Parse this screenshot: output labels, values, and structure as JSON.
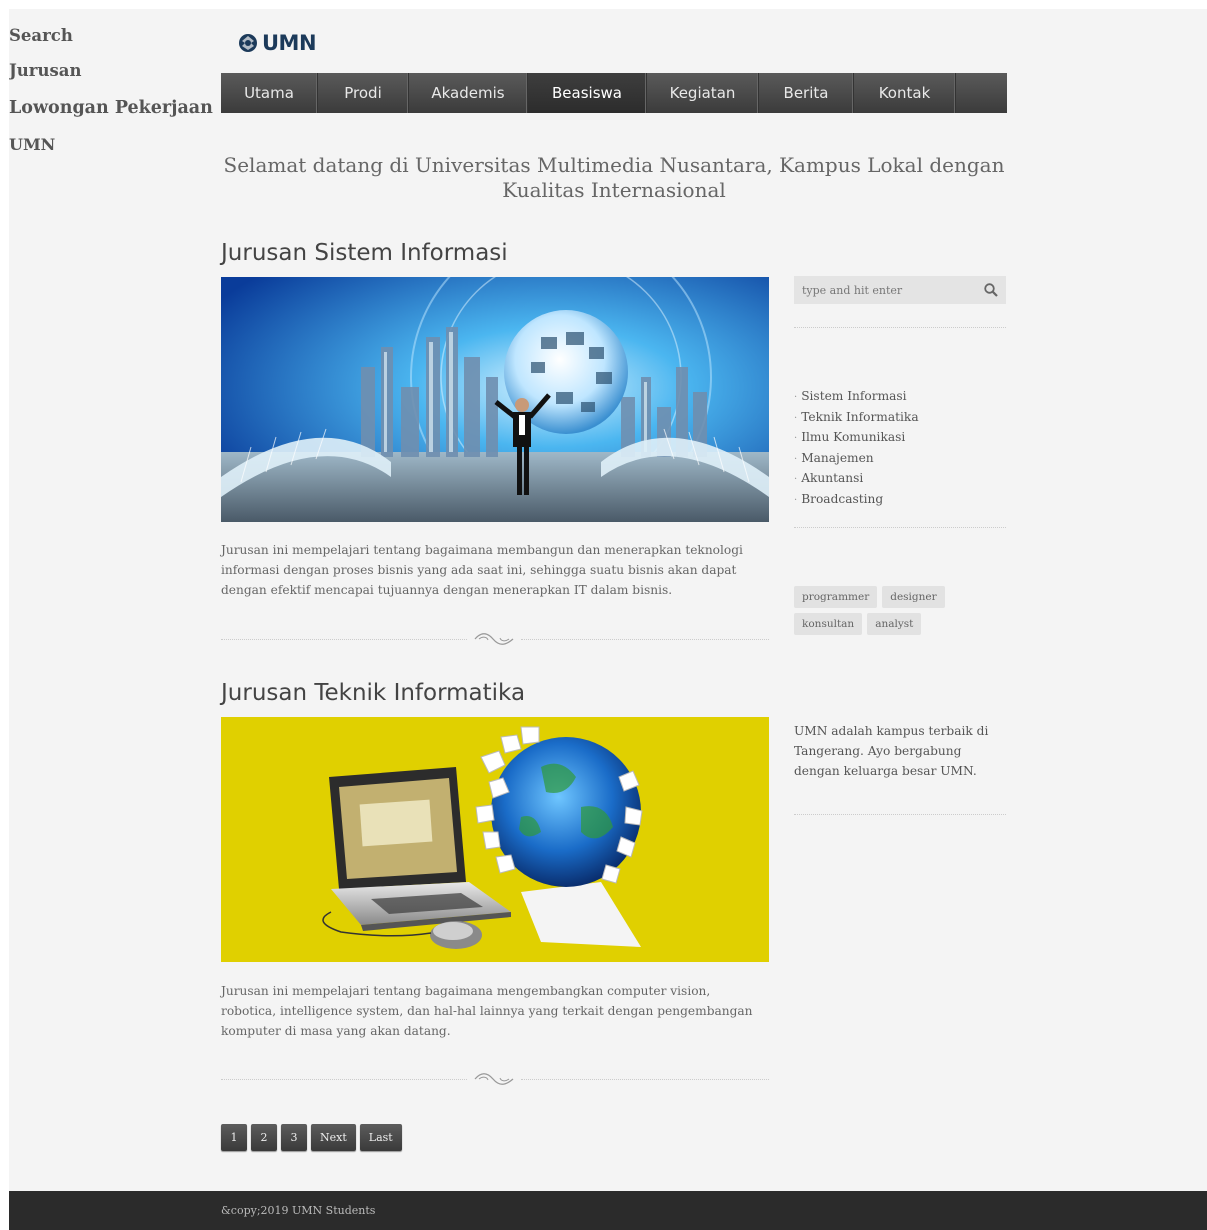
{
  "logo": {
    "text": "UMN"
  },
  "nav": {
    "items": [
      "Utama",
      "Prodi",
      "Akademis",
      "Beasiswa",
      "Kegiatan",
      "Berita",
      "Kontak"
    ],
    "active": "Beasiswa"
  },
  "tagline": "Selamat datang di Universitas Multimedia Nusantara, Kampus Lokal dengan Kualitas Internasional",
  "posts": [
    {
      "title": "Jurusan Sistem Informasi",
      "text": "Jurusan ini mempelajari tentang bagaimana membangun dan menerapkan teknologi informasi dengan proses bisnis yang ada saat ini, sehingga suatu bisnis akan dapat dengan efektif mencapai tujuannya dengan menerapkan IT dalam bisnis."
    },
    {
      "title": "Jurusan Teknik Informatika",
      "text": "Jurusan ini mempelajari tentang bagaimana mengembangkan computer vision, robotica, intelligence system, dan hal-hal lainnya yang terkait dengan pengembangan komputer di masa yang akan datang."
    }
  ],
  "pagination": [
    "1",
    "2",
    "3",
    "Next",
    "Last"
  ],
  "sidebar": {
    "search": {
      "title": "Search",
      "placeholder": "type and hit enter"
    },
    "jurusan": {
      "title": "Jurusan",
      "items": [
        "Sistem Informasi",
        "Teknik Informatika",
        "Ilmu Komunikasi",
        "Manajemen",
        "Akuntansi",
        "Broadcasting"
      ]
    },
    "lowongan": {
      "title": "Lowongan Pekerjaan",
      "tags": [
        "programmer",
        "designer",
        "konsultan",
        "analyst"
      ]
    },
    "umn": {
      "title": "UMN",
      "text": "UMN adalah kampus terbaik di Tangerang. Ayo bergabung dengan keluarga besar UMN."
    }
  },
  "footer": {
    "text": "&copy;2019 UMN Students"
  },
  "colors": {
    "nav": "#4a4a4a",
    "footer": "#2b2b2b",
    "page_bg": "#f4f4f4",
    "yellow": "#e0d000"
  },
  "icons": {
    "search": "search-icon",
    "divider": "swirl-ornament-icon",
    "logo": "umn-logo-icon"
  }
}
